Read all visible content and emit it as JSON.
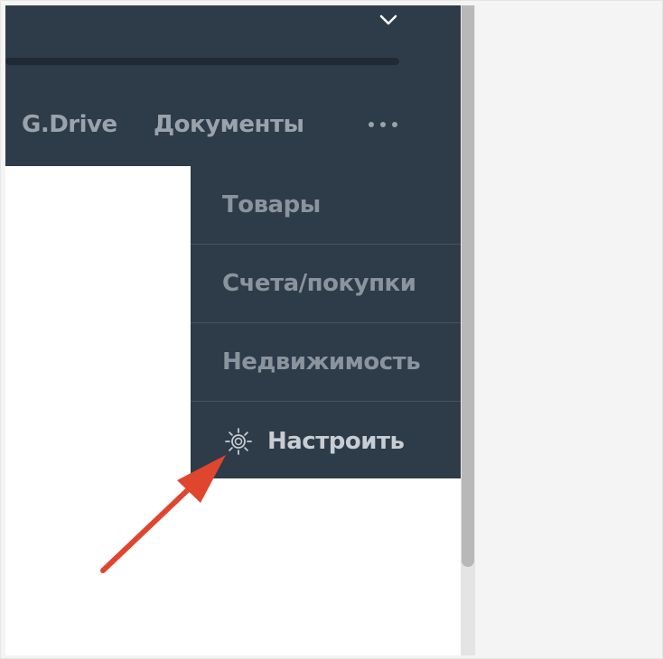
{
  "header": {
    "chevron_icon": "chevron-down-icon",
    "nav": {
      "gdrive": "G.Drive",
      "documents": "Документы",
      "more_icon": "more-dots-icon"
    }
  },
  "dropdown": {
    "items": [
      {
        "label": "Товары"
      },
      {
        "label": "Счета/покупки"
      },
      {
        "label": "Недвижимость"
      },
      {
        "label": "Настроить",
        "icon": "gear-icon"
      }
    ]
  },
  "annotation": {
    "arrow_color": "#e0452e"
  },
  "colors": {
    "header_bg": "#2e3b48",
    "nav_text": "#9aa3ab",
    "configure_text": "#c7cdd2",
    "content_bg": "#ffffff"
  }
}
